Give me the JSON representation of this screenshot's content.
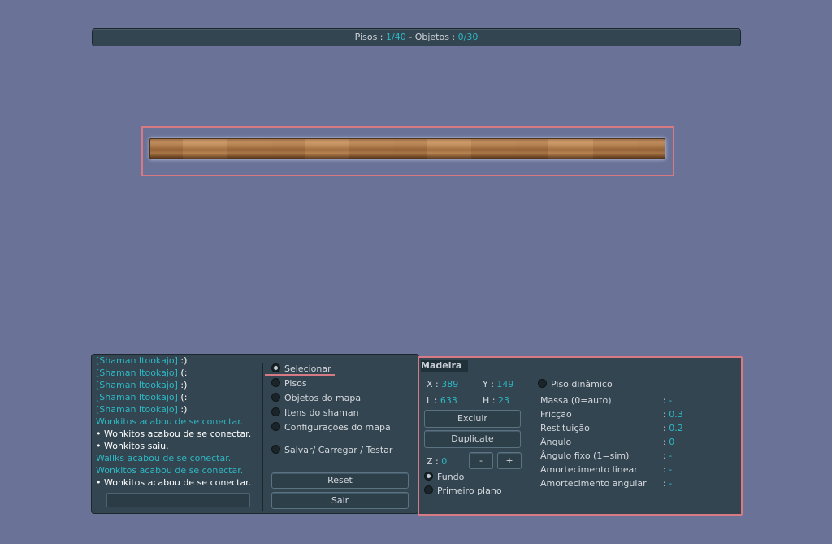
{
  "topbar": {
    "pisos_label": "Pisos : ",
    "pisos_value": "1/40",
    "sep": " - ",
    "objetos_label": "Objetos : ",
    "objetos_value": "0/30"
  },
  "chat": {
    "lines": [
      {
        "tag": "[Shaman Itookajo]",
        "msg": " :)"
      },
      {
        "tag": "[Shaman Itookajo]",
        "msg": " (:"
      },
      {
        "tag": "[Shaman Itookajo]",
        "msg": " :)"
      },
      {
        "tag": "[Shaman Itookajo]",
        "msg": " (:"
      },
      {
        "tag": "[Shaman Itookajo]",
        "msg": " :)"
      },
      {
        "text": "Wonkitos acabou de se conectar.",
        "color": "green"
      },
      {
        "text": "• Wonkitos acabou de se conectar.",
        "color": "white"
      },
      {
        "text": "• Wonkitos saiu.",
        "color": "white"
      },
      {
        "text": "Wallks acabou de se conectar.",
        "color": "green"
      },
      {
        "text": "Wonkitos acabou de se conectar.",
        "color": "green"
      },
      {
        "text": "• Wonkitos acabou de se conectar.",
        "color": "white"
      }
    ],
    "input_value": ""
  },
  "menu": {
    "selecionar": "Selecionar",
    "pisos": "Pisos",
    "objetos": "Objetos do mapa",
    "itens": "Itens do shaman",
    "config": "Configurações do mapa",
    "salvar": "Salvar/ Carregar / Testar",
    "reset": "Reset",
    "sair": "Sair",
    "selected": "Selecionar"
  },
  "props": {
    "title": "Madeira",
    "x_label": "X : ",
    "x_value": "389",
    "y_label": "Y : ",
    "y_value": "149",
    "l_label": "L : ",
    "l_value": "633",
    "h_label": "H : ",
    "h_value": "23",
    "excluir": "Excluir",
    "duplicate": "Duplicate",
    "z_label": "Z : ",
    "z_value": "0",
    "minus": "-",
    "plus": "+",
    "fundo": "Fundo",
    "primeiro_plano": "Primeiro plano",
    "piso_dinamico": "Piso dinâmico",
    "massa_label": "Massa (0=auto)",
    "massa_value": "-",
    "friccao_label": "Fricção",
    "friccao_value": "0.3",
    "restituicao_label": "Restituição",
    "restituicao_value": "0.2",
    "angulo_label": "Ângulo",
    "angulo_value": "0",
    "angulo_fixo_label": "Ângulo fixo (1=sim)",
    "angulo_fixo_value": "-",
    "amort_linear_label": "Amortecimento linear",
    "amort_linear_value": "-",
    "amort_angular_label": "Amortecimento angular",
    "amort_angular_value": "-",
    "colon": ":"
  },
  "colors": {
    "background": "#6a7297",
    "panel": "#324550",
    "accent_cyan": "#2fb7c4",
    "selection_red": "#d77a84",
    "wood": "#b7814f"
  }
}
